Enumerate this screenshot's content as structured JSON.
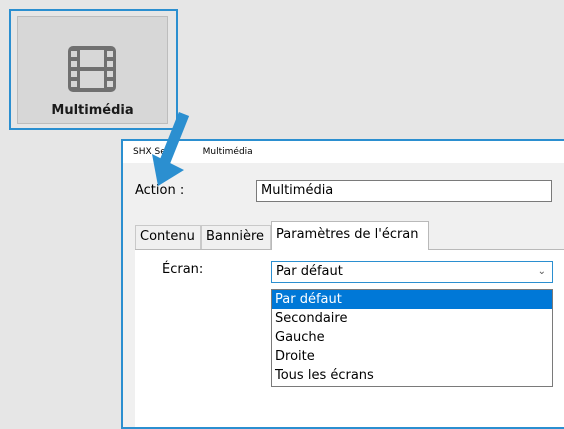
{
  "tile": {
    "label": "Multimédia",
    "icon": "film-icon"
  },
  "dialog": {
    "title": "SHX Se",
    "title_rest": "Multimédia",
    "close": "X",
    "action_label": "Action :",
    "action_value": "Multimédia",
    "tabs": [
      {
        "label": "Contenu"
      },
      {
        "label": "Bannière"
      },
      {
        "label": "Paramètres de l'écran",
        "active": true
      }
    ],
    "ecran_label": "Écran:",
    "select_value": "Par défaut",
    "options": [
      "Par défaut",
      "Secondaire",
      "Gauche",
      "Droite",
      "Tous les écrans"
    ]
  },
  "colors": {
    "accent": "#2b8fd0",
    "selection": "#0078d7"
  }
}
